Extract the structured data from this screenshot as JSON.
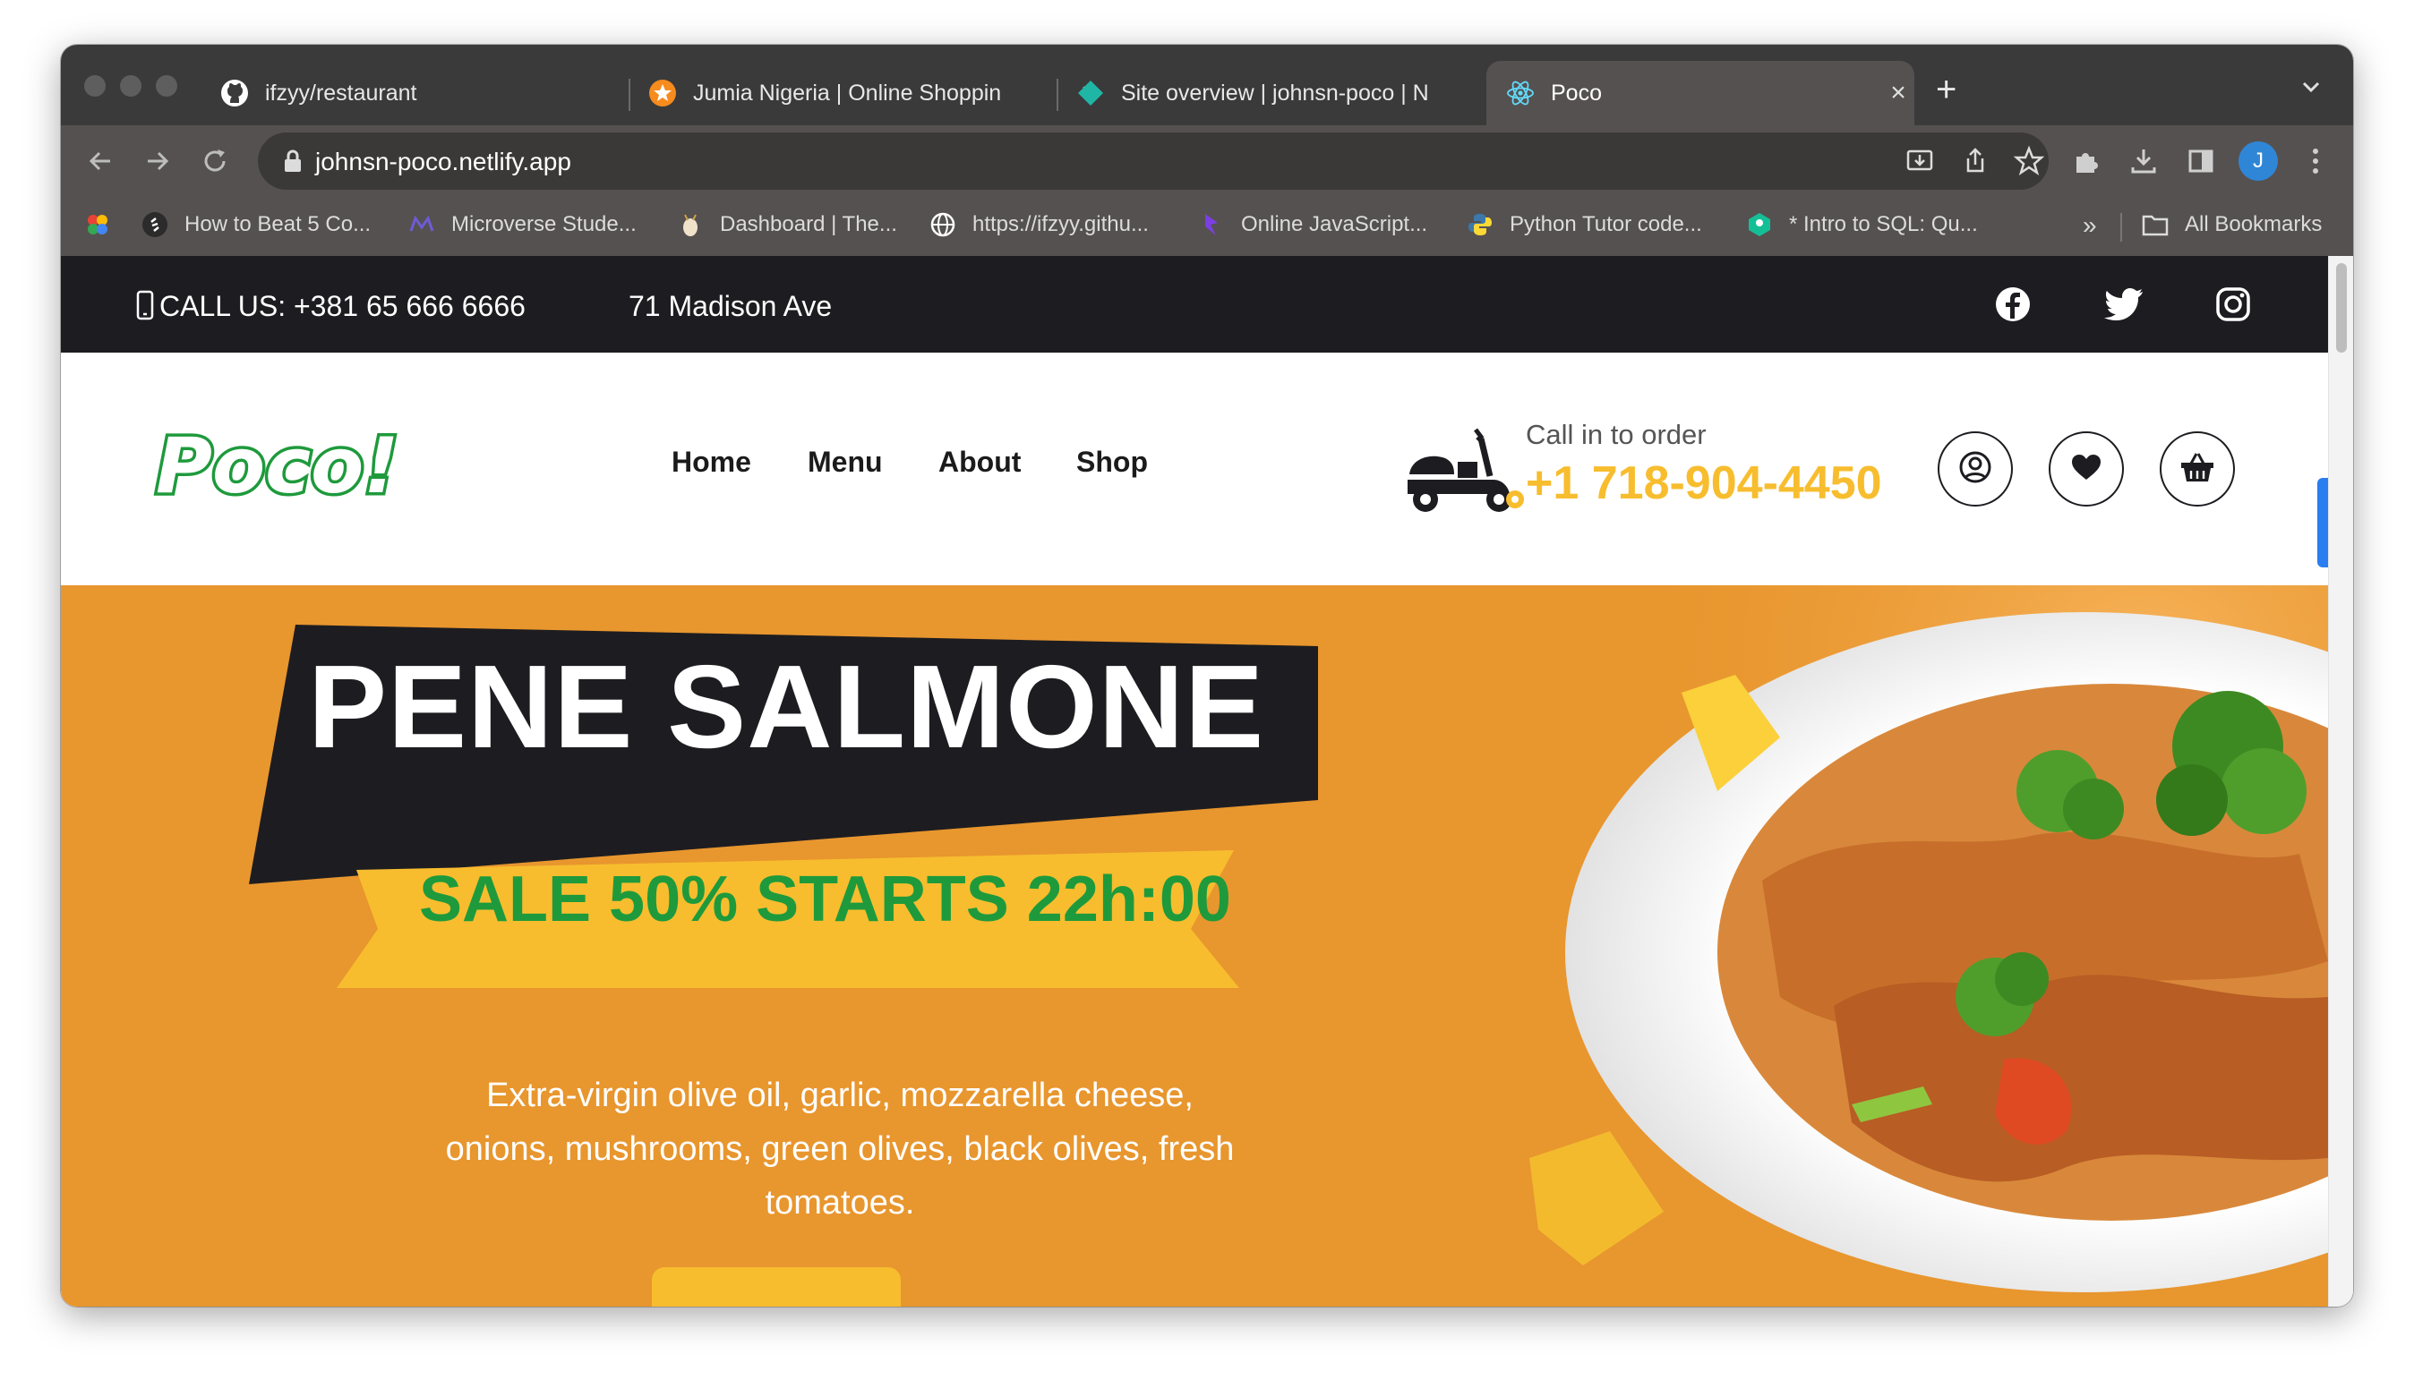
{
  "browser": {
    "tabs": [
      {
        "title": "ifzyy/restaurant",
        "favicon": "github-icon"
      },
      {
        "title": "Jumia Nigeria | Online Shoppin",
        "favicon": "jumia-icon"
      },
      {
        "title": "Site overview | johnsn-poco | N",
        "favicon": "netlify-icon"
      },
      {
        "title": "Poco",
        "favicon": "react-icon"
      }
    ],
    "new_tab": "+",
    "close_glyph": "×",
    "url": "johnsn-poco.netlify.app",
    "profile_initial": "J",
    "bookmarks": [
      {
        "label": "How to Beat 5 Co...",
        "icon": "bookmark-icon"
      },
      {
        "label": "Microverse Stude...",
        "icon": "microverse-icon"
      },
      {
        "label": "Dashboard | The...",
        "icon": "dashboard-icon"
      },
      {
        "label": "https://ifzyy.githu...",
        "icon": "globe-icon"
      },
      {
        "label": "Online JavaScript...",
        "icon": "code-icon"
      },
      {
        "label": "Python Tutor code...",
        "icon": "python-icon"
      },
      {
        "label": "* Intro to SQL: Qu...",
        "icon": "khan-icon"
      }
    ],
    "more_bookmarks": "»",
    "all_bookmarks": "All Bookmarks"
  },
  "site": {
    "topbar": {
      "call": "CALL US: +381 65 666 6666",
      "address": "71 Madison Ave"
    },
    "logo": "Poco!",
    "nav": [
      "Home",
      "Menu",
      "About",
      "Shop"
    ],
    "call_label": "Call in to order",
    "phone": "+1 718-904-4450",
    "hero": {
      "title": "PENE SALMONE",
      "sale": "SALE 50% STARTS 22h:00",
      "description": "Extra-virgin olive oil, garlic, mozzarella cheese, onions, mushrooms, green olives, black olives, fresh tomatoes."
    }
  },
  "colors": {
    "accent_yellow": "#f7bd2e",
    "hero_orange": "#e8962e",
    "brand_green": "#1e9a3c",
    "dark": "#1d1d21"
  }
}
